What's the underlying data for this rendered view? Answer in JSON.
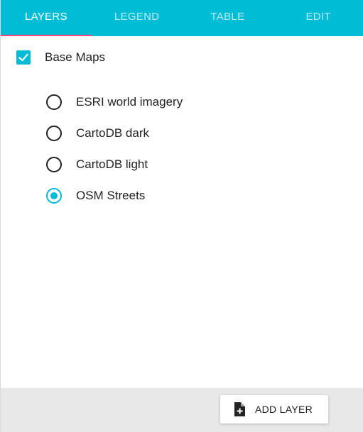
{
  "colors": {
    "accent": "#00bcd4",
    "tab_indicator": "#ff4081",
    "text": "#222222",
    "footer_bg": "#e8e8e8"
  },
  "tabs": [
    {
      "label": "LAYERS",
      "active": true
    },
    {
      "label": "LEGEND",
      "active": false
    },
    {
      "label": "TABLE",
      "active": false
    },
    {
      "label": "EDIT",
      "active": false
    }
  ],
  "base_maps": {
    "label": "Base Maps",
    "checked": true,
    "options": [
      {
        "label": "ESRI world imagery",
        "selected": false
      },
      {
        "label": "CartoDB dark",
        "selected": false
      },
      {
        "label": "CartoDB light",
        "selected": false
      },
      {
        "label": "OSM Streets",
        "selected": true
      }
    ]
  },
  "footer": {
    "add_layer_label": "ADD LAYER",
    "add_layer_icon": "file-plus-icon"
  }
}
